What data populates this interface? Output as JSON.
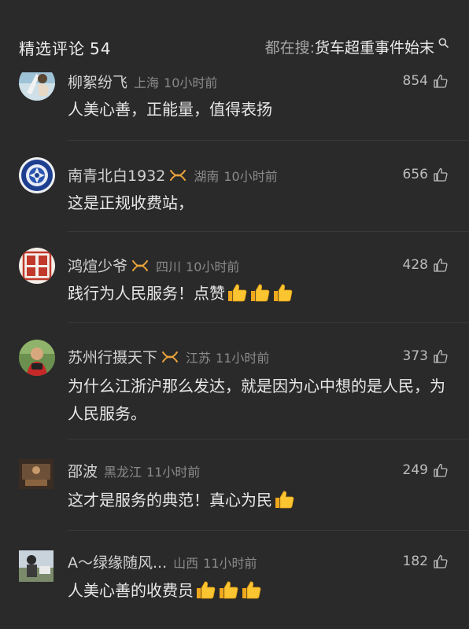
{
  "header": {
    "title": "精选评论",
    "count": "54",
    "search_prefix": "都在搜: ",
    "search_topic": "货车超重事件始末"
  },
  "comments": [
    {
      "username": "柳絮纷飞",
      "badge": false,
      "location": "上海",
      "time": "10小时前",
      "likes": "854",
      "text": "人美心善，正能量，值得表扬",
      "emoji_count": 0
    },
    {
      "username": "南青北白1932",
      "badge": true,
      "location": "湖南",
      "time": "10小时前",
      "likes": "656",
      "text": "这是正规收费站，",
      "emoji_count": 0
    },
    {
      "username": "鸿煊少爷",
      "badge": true,
      "location": "四川",
      "time": "10小时前",
      "likes": "428",
      "text": "践行为人民服务！点赞",
      "emoji_count": 3
    },
    {
      "username": "苏州行摄天下",
      "badge": true,
      "location": "江苏",
      "time": "11小时前",
      "likes": "373",
      "text": "为什么江浙沪那么发达，就是因为心中想的是人民，为人民服务。",
      "emoji_count": 0
    },
    {
      "username": "邵波",
      "badge": false,
      "location": "黑龙江",
      "time": "11小时前",
      "likes": "249",
      "text": "这才是服务的典范！真心为民",
      "emoji_count": 1
    },
    {
      "username": "A～绿缘随风...",
      "badge": false,
      "location": "山西",
      "time": "11小时前",
      "likes": "182",
      "text": "人美心善的收费员",
      "emoji_count": 3
    }
  ],
  "colors": {
    "background": "#2a2a2a",
    "text": "#e8e8e8",
    "muted": "#8a8a8a",
    "badge": "#e8a23a"
  }
}
